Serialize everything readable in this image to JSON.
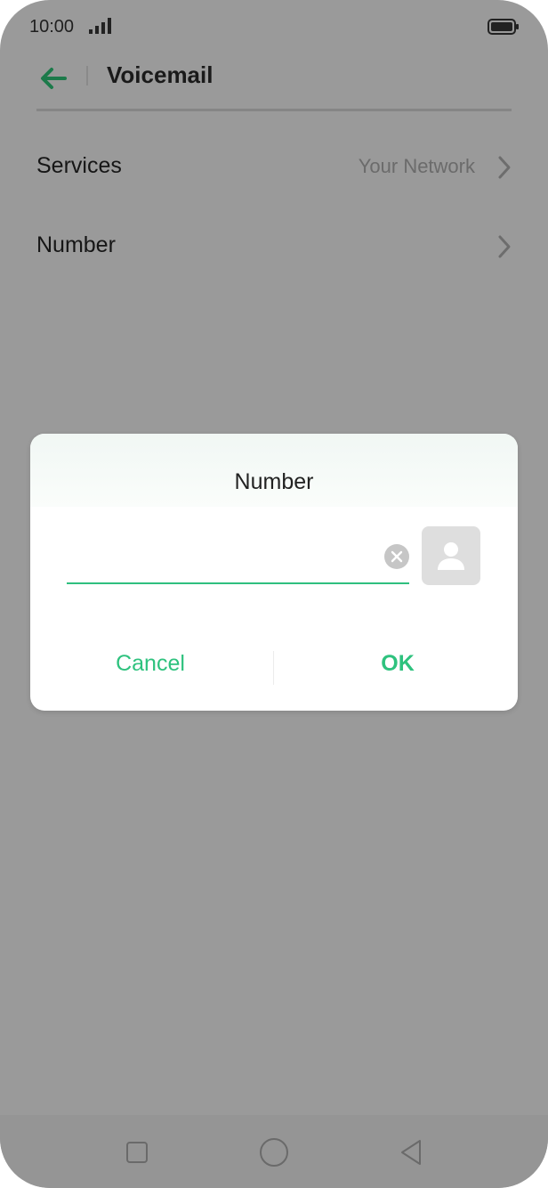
{
  "status_bar": {
    "time": "10:00",
    "signal_icon": "signal-icon",
    "battery_icon": "battery-icon"
  },
  "header": {
    "title": "Voicemail",
    "back_icon": "arrow-left-icon"
  },
  "settings": {
    "rows": [
      {
        "label": "Services",
        "value": "Your Network"
      },
      {
        "label": "Number",
        "value": ""
      }
    ]
  },
  "dialog": {
    "title": "Number",
    "input_value": "",
    "input_placeholder": "",
    "cancel_label": "Cancel",
    "ok_label": "OK",
    "contact_icon": "contact-icon",
    "clear_icon": "clear-icon"
  },
  "colors": {
    "accent": "#2ec27e",
    "back_arrow": "#1c7a4a",
    "scrim": "#9a9a9a"
  }
}
